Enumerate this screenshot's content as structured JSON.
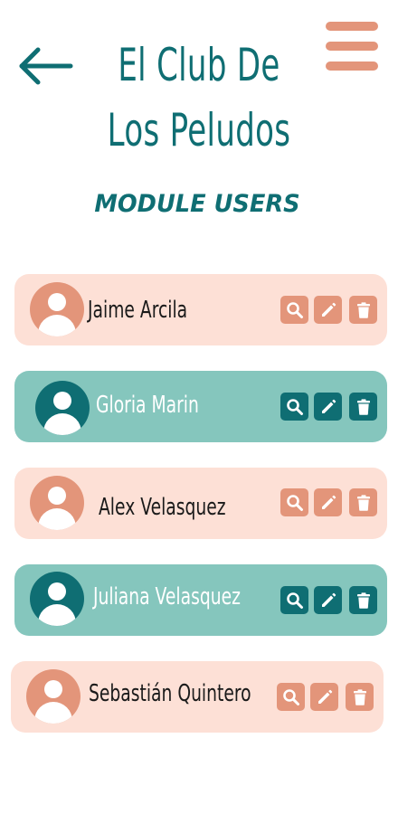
{
  "header": {
    "title": "El Club De Los Peludos",
    "subtitle": "MODULE USERS"
  },
  "icons": {
    "back": "arrow-left-icon",
    "menu": "hamburger-menu-icon",
    "avatar": "user-avatar-icon",
    "view": "search-icon",
    "edit": "pencil-icon",
    "delete": "trash-icon"
  },
  "colors": {
    "primary": "#0f6e73",
    "accent": "#e3957a",
    "card_light": "#fde0d6",
    "card_teal": "#85c6bd"
  },
  "users": [
    {
      "name": "Jaime Arcila",
      "style": "light"
    },
    {
      "name": "Gloria Marin",
      "style": "teal"
    },
    {
      "name": "Alex Velasquez",
      "style": "light"
    },
    {
      "name": "Juliana Velasquez",
      "style": "teal"
    },
    {
      "name": "Sebastián Quintero",
      "style": "light"
    }
  ]
}
